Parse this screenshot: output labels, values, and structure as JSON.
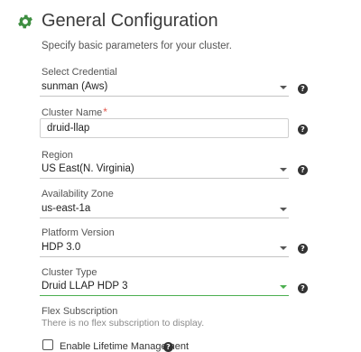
{
  "header": {
    "icon": "gear-icon",
    "title": "General Configuration",
    "subtitle": "Specify basic parameters for your cluster."
  },
  "fields": {
    "credential": {
      "label": "Select Credential",
      "value": "sunman (Aws)"
    },
    "cluster_name": {
      "label": "Cluster Name",
      "required_mark": "*",
      "value": "druid-llap"
    },
    "region": {
      "label": "Region",
      "value": "US East(N. Virginia)"
    },
    "availability_zone": {
      "label": "Availability Zone",
      "value": "us-east-1a"
    },
    "platform_version": {
      "label": "Platform Version",
      "value": "HDP 3.0"
    },
    "cluster_type": {
      "label": "Cluster Type",
      "value": "Druid LLAP HDP 3"
    },
    "flex_subscription": {
      "label": "Flex Subscription",
      "message": "There is no flex subscription to display."
    },
    "lifetime_management": {
      "label": "Enable Lifetime Management",
      "checked": false
    }
  },
  "help_glyph": "?",
  "colors": {
    "accent_green": "#4caf50",
    "required_red": "#e2574c",
    "icon_green": "#3e8e41"
  }
}
